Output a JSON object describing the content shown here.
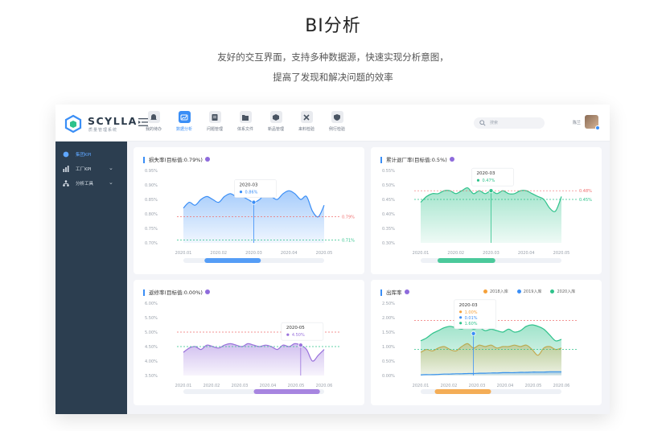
{
  "hero": {
    "title": "BI分析",
    "subtitle_line1": "友好的交互界面，支持多种数据源，快速实现分析意图，",
    "subtitle_line2": "提高了发现和解决问题的效率"
  },
  "app": {
    "logo_text": "SCYLLA",
    "logo_sub": "质量管理系统",
    "nav": [
      {
        "label": "我的待办",
        "icon": "bell-icon",
        "active": false
      },
      {
        "label": "数据分析",
        "icon": "chart-icon",
        "active": true
      },
      {
        "label": "问题管理",
        "icon": "issue-icon",
        "active": false
      },
      {
        "label": "体系文件",
        "icon": "folder-icon",
        "active": false
      },
      {
        "label": "新品管理",
        "icon": "box-icon",
        "active": false
      },
      {
        "label": "来料检验",
        "icon": "tools-icon",
        "active": false
      },
      {
        "label": "例行检验",
        "icon": "shield-icon",
        "active": false
      }
    ],
    "search_placeholder": "搜索",
    "user_name": "陈兰",
    "sidebar": [
      {
        "label": "集团KPI",
        "icon": "globe-icon",
        "active": true,
        "chevron": false
      },
      {
        "label": "工厂KPI",
        "icon": "bar-icon",
        "active": false,
        "chevron": true
      },
      {
        "label": "分析工具",
        "icon": "tree-icon",
        "active": false,
        "chevron": true
      }
    ]
  },
  "colors": {
    "blue": "#3a8ef6",
    "green": "#2ec28b",
    "purple": "#9a72dc",
    "orange": "#f5a13a",
    "red_line": "#f07070",
    "sidebar": "#2c3e50"
  },
  "chart_data": [
    {
      "type": "area",
      "title": "损失率(目标值:0.79%)",
      "color": "#3a8ef6",
      "x_ticks": [
        "2020.01",
        "2020.02",
        "2020.03",
        "2020.04",
        "2020.05"
      ],
      "y_ticks": [
        "0.95%",
        "0.90%",
        "0.85%",
        "0.80%",
        "0.75%",
        "0.70%"
      ],
      "ylim": [
        0.7,
        0.95
      ],
      "series": [
        {
          "values": [
            0.82,
            0.84,
            0.83,
            0.85,
            0.86,
            0.85,
            0.84,
            0.86,
            0.87,
            0.86,
            0.86,
            0.85,
            0.84,
            0.85,
            0.87,
            0.86,
            0.85,
            0.87,
            0.88,
            0.87,
            0.85,
            0.86,
            0.81,
            0.79,
            0.83
          ]
        }
      ],
      "ref_lines": [
        {
          "value": 0.79,
          "label": "0.79%",
          "color": "#f07070"
        },
        {
          "value": 0.71,
          "label": "0.71%",
          "color": "#2ec28b"
        }
      ],
      "tooltip": {
        "period": "2020-03",
        "value": "0.86%",
        "at": 12
      },
      "scrollbar": [
        0.15,
        0.55
      ]
    },
    {
      "type": "area",
      "title": "累计退厂率(目标值:0.5%)",
      "color": "#2ec28b",
      "x_ticks": [
        "2020.01",
        "2020.02",
        "2020.03",
        "2020.04",
        "2020.05"
      ],
      "y_ticks": [
        "0.55%",
        "0.50%",
        "0.45%",
        "0.40%",
        "0.35%",
        "0.30%"
      ],
      "ylim": [
        0.3,
        0.55
      ],
      "series": [
        {
          "values": [
            0.44,
            0.46,
            0.47,
            0.47,
            0.48,
            0.48,
            0.47,
            0.48,
            0.49,
            0.47,
            0.48,
            0.47,
            0.48,
            0.47,
            0.48,
            0.47,
            0.47,
            0.48,
            0.48,
            0.47,
            0.46,
            0.45,
            0.42,
            0.41,
            0.46
          ]
        }
      ],
      "ref_lines": [
        {
          "value": 0.48,
          "label": "0.48%",
          "color": "#f07070"
        },
        {
          "value": 0.45,
          "label": "0.45%",
          "color": "#2ec28b"
        }
      ],
      "tooltip": {
        "period": "2020-03",
        "value": "0.47%",
        "at": 12
      },
      "scrollbar": [
        0.12,
        0.53
      ]
    },
    {
      "type": "area",
      "title": "返修率(目标值:0.00%)",
      "color": "#9a72dc",
      "x_ticks": [
        "2020.01",
        "2020.02",
        "2020.03",
        "2020.04",
        "2020.05",
        "2020.06"
      ],
      "y_ticks": [
        "6.00%",
        "5.50%",
        "5.00%",
        "4.50%",
        "4.00%",
        "3.50%"
      ],
      "ylim": [
        3.5,
        6.0
      ],
      "series": [
        {
          "values": [
            4.3,
            4.45,
            4.5,
            4.4,
            4.55,
            4.5,
            4.45,
            4.55,
            4.6,
            4.55,
            4.5,
            4.6,
            4.55,
            4.5,
            4.55,
            4.5,
            4.4,
            4.55,
            4.5,
            4.6,
            4.55,
            4.4,
            4.0,
            4.2,
            4.4
          ]
        }
      ],
      "ref_lines": [
        {
          "value": 5.0,
          "label": "",
          "color": "#f07070"
        },
        {
          "value": 4.5,
          "label": "",
          "color": "#2ec28b"
        }
      ],
      "tooltip": {
        "period": "2020-05",
        "value": "4.50%",
        "at": 20
      },
      "scrollbar": [
        0.5,
        0.97
      ]
    },
    {
      "type": "area",
      "title": "出库率",
      "x_ticks": [
        "2020.01",
        "2020.02",
        "2020.03",
        "2020.04",
        "2020.05",
        "2020.06"
      ],
      "y_ticks": [
        "2.50%",
        "2.00%",
        "1.50%",
        "1.00%",
        "0.50%",
        "0.00%"
      ],
      "ylim": [
        0.0,
        2.5
      ],
      "legend": [
        "2018入库",
        "2019入库",
        "2020入库"
      ],
      "series": [
        {
          "name": "2018入库",
          "color": "#f5a13a",
          "values": [
            0.8,
            0.9,
            0.85,
            0.95,
            1.0,
            0.9,
            0.85,
            1.0,
            1.1,
            0.95,
            1.05,
            1.0,
            1.05,
            0.95,
            1.0,
            1.0,
            1.05,
            1.0,
            1.05,
            0.9,
            0.7,
            0.95,
            1.0,
            0.9,
            0.95
          ]
        },
        {
          "name": "2019入库",
          "color": "#3a8ef6",
          "values": [
            0.02,
            0.03,
            0.03,
            0.04,
            0.05,
            0.05,
            0.06,
            0.06,
            0.07,
            0.07,
            0.08,
            0.08,
            0.09,
            0.09,
            0.1,
            0.1,
            0.1,
            0.11,
            0.11,
            0.12,
            0.12,
            0.12,
            0.13,
            0.13,
            0.13
          ]
        },
        {
          "name": "2020入库",
          "color": "#2ec28b",
          "values": [
            1.2,
            1.3,
            1.45,
            1.55,
            1.65,
            1.7,
            1.65,
            1.6,
            1.7,
            1.6,
            1.65,
            1.55,
            1.6,
            1.55,
            1.5,
            1.6,
            1.5,
            1.55,
            1.7,
            1.75,
            1.7,
            1.6,
            1.4,
            1.2,
            1.25
          ]
        }
      ],
      "ref_lines": [
        {
          "value": 1.9,
          "label": "",
          "color": "#f07070"
        },
        {
          "value": 0.9,
          "label": "",
          "color": "#2ec28b"
        }
      ],
      "tooltip": {
        "period": "2020-03",
        "values": [
          "1.00%",
          "0.01%",
          "1.60%"
        ],
        "at": 9
      },
      "scrollbar": [
        0.1,
        0.5
      ]
    }
  ]
}
